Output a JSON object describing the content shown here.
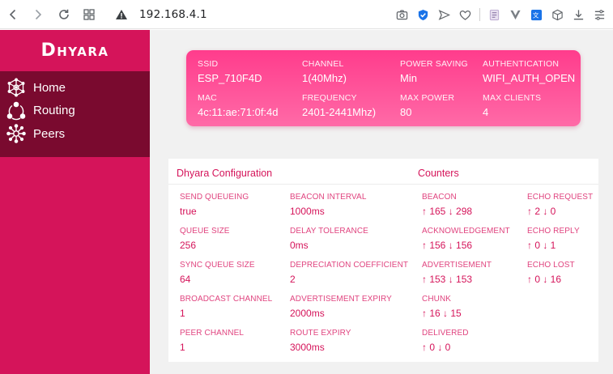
{
  "browser": {
    "url": "192.168.4.1"
  },
  "sidebar": {
    "brand": "Dhyara",
    "items": [
      {
        "label": "Home",
        "icon": "network-graph-icon"
      },
      {
        "label": "Routing",
        "icon": "route-cycle-icon"
      },
      {
        "label": "Peers",
        "icon": "peers-star-icon"
      }
    ]
  },
  "ap": {
    "ssid_label": "SSID",
    "ssid": "ESP_710F4D",
    "channel_label": "CHANNEL",
    "channel": "1(40Mhz)",
    "power_label": "POWER SAVING",
    "power": "Min",
    "auth_label": "AUTHENTICATION",
    "auth": "WIFI_AUTH_OPEN",
    "mac_label": "MAC",
    "mac": "4c:11:ae:71:0f:4d",
    "freq_label": "FREQUENCY",
    "freq": "2401-2441Mhz)",
    "maxpower_label": "MAX POWER",
    "maxpower": "80",
    "maxclients_label": "MAX CLIENTS",
    "maxclients": "4"
  },
  "config": {
    "title": "Dhyara Configuration",
    "items": [
      {
        "label": "SEND QUEUEING",
        "value": "true"
      },
      {
        "label": "BEACON INTERVAL",
        "value": "1000ms"
      },
      {
        "label": "QUEUE SIZE",
        "value": "256"
      },
      {
        "label": "DELAY TOLERANCE",
        "value": "0ms"
      },
      {
        "label": "SYNC QUEUE SIZE",
        "value": "64"
      },
      {
        "label": "DEPRECIATION COEFFICIENT",
        "value": "2"
      },
      {
        "label": "BROADCAST CHANNEL",
        "value": "1"
      },
      {
        "label": "ADVERTISEMENT EXPIRY",
        "value": "2000ms"
      },
      {
        "label": "PEER CHANNEL",
        "value": "1"
      },
      {
        "label": "ROUTE EXPIRY",
        "value": "3000ms"
      }
    ]
  },
  "counters": {
    "title": "Counters",
    "items": [
      {
        "label": "BEACON",
        "value": "↑ 165 ↓ 298"
      },
      {
        "label": "ECHO REQUEST",
        "value": "↑ 2 ↓ 0"
      },
      {
        "label": "ACKNOWLEDGEMENT",
        "value": "↑ 156 ↓ 156"
      },
      {
        "label": "ECHO REPLY",
        "value": "↑ 0 ↓ 1"
      },
      {
        "label": "ADVERTISEMENT",
        "value": "↑ 153 ↓ 153"
      },
      {
        "label": "ECHO LOST",
        "value": "↑ 0 ↓ 16"
      },
      {
        "label": "CHUNK",
        "value": "↑ 16 ↓ 15"
      },
      {
        "label": "DELIVERED",
        "value": "↑ 0 ↓ 0"
      }
    ]
  },
  "colors": {
    "sidebar": "#d5145a",
    "sidebar_active": "#7a0a2f",
    "accent": "#ff3c8c",
    "text_accent": "#d5145a"
  }
}
